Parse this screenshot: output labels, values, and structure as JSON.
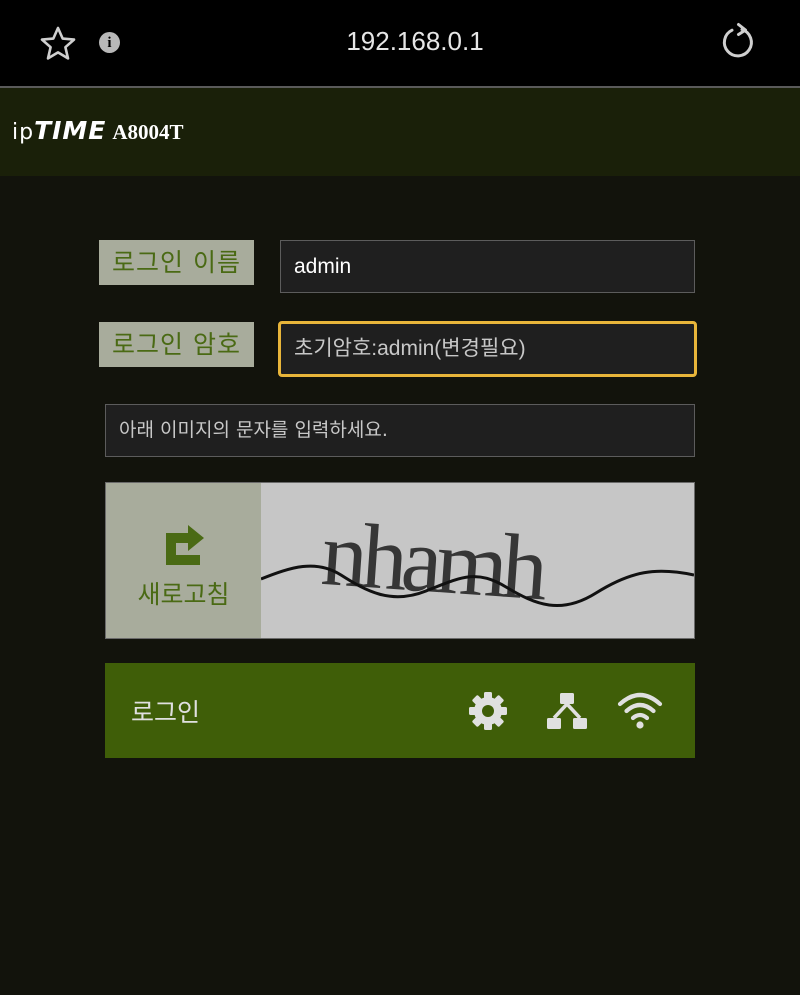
{
  "browser": {
    "url": "192.168.0.1",
    "info_glyph": "i"
  },
  "header": {
    "brand_ip": "ip",
    "brand_time": "TIME",
    "model": "A8004T"
  },
  "form": {
    "username_label": "로그인 이름",
    "username_value": "admin",
    "password_label": "로그인 암호",
    "password_placeholder": "초기암호:admin(변경필요)",
    "captcha_hint": "아래 이미지의 문자를 입력하세요.",
    "captcha_text": "nhamh",
    "refresh_label": "새로고침",
    "login_label": "로그인"
  },
  "icons": {
    "bookmark": "star-icon",
    "info": "info-icon",
    "reload": "reload-icon",
    "refresh": "refresh-arrow-icon",
    "settings": "gear-icon",
    "network": "network-icon",
    "wifi": "wifi-icon"
  },
  "colors": {
    "accent_green": "#3f5e08",
    "label_green": "#4a6a14",
    "focus_border": "#e8b53a"
  }
}
